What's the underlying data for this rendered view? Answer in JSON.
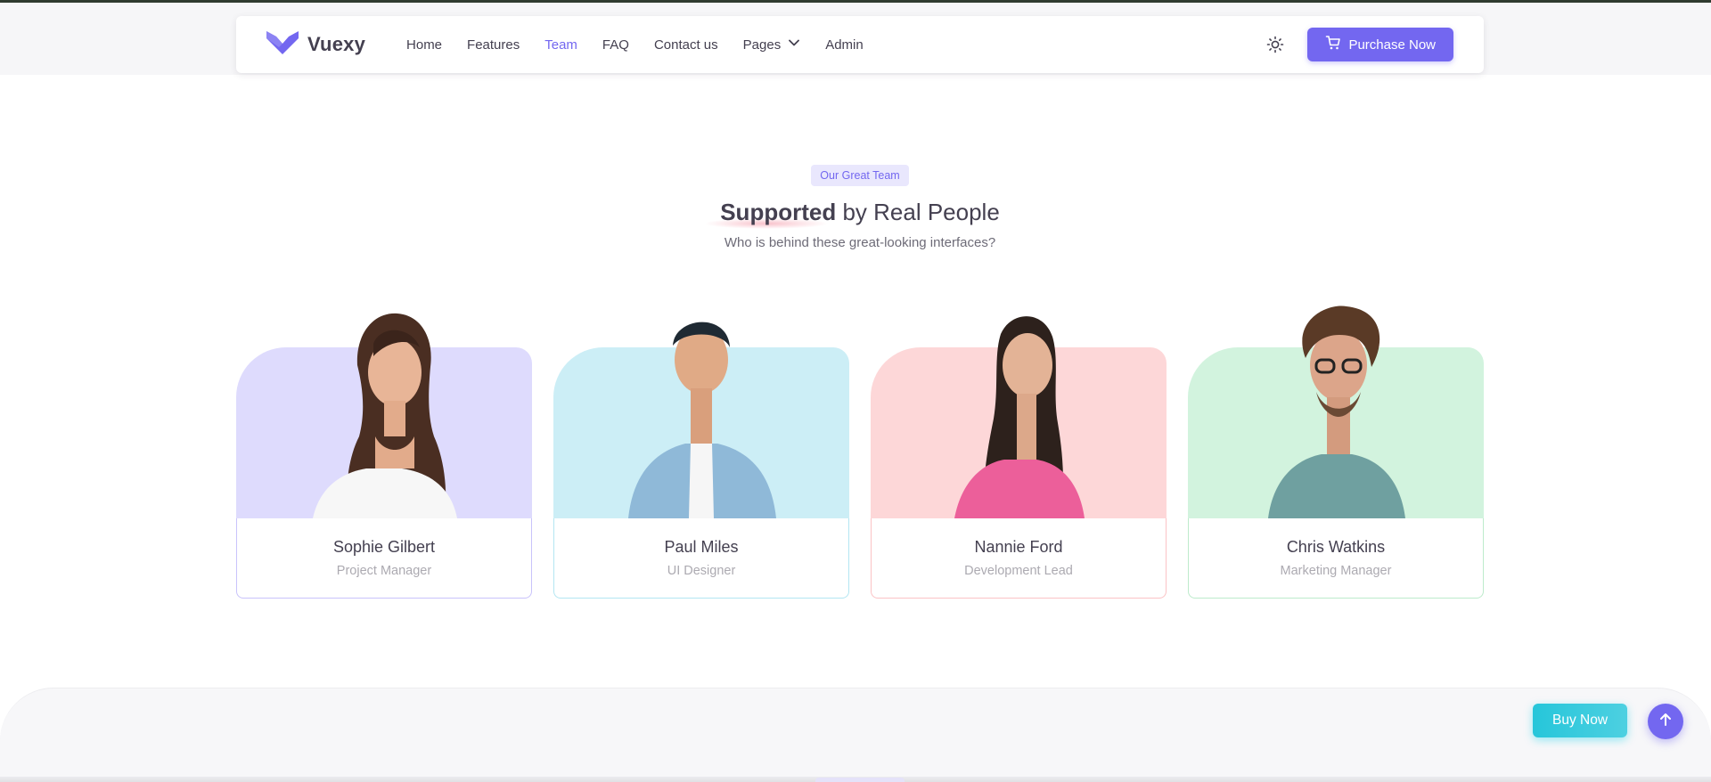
{
  "brand": {
    "name": "Vuexy",
    "accent": "#7367f0"
  },
  "nav": {
    "items": [
      {
        "label": "Home"
      },
      {
        "label": "Features"
      },
      {
        "label": "Team",
        "active": true
      },
      {
        "label": "FAQ"
      },
      {
        "label": "Contact us"
      },
      {
        "label": "Pages",
        "dropdown": true
      },
      {
        "label": "Admin"
      }
    ],
    "theme_icon": "sun-icon",
    "purchase_label": "Purchase Now",
    "purchase_icon": "cart-icon"
  },
  "section": {
    "badge": "Our Great Team",
    "title_strong": "Supported",
    "title_rest": " by Real People",
    "subtitle": "Who is behind these great-looking interfaces?"
  },
  "team": [
    {
      "name": "Sophie Gilbert",
      "role": "Project Manager",
      "bg": "#dedbfd",
      "border": "#c9c3fb"
    },
    {
      "name": "Paul Miles",
      "role": "UI Designer",
      "bg": "#cceef6",
      "border": "#b3e6f2"
    },
    {
      "name": "Nannie Ford",
      "role": "Development Lead",
      "bg": "#fdd7d8",
      "border": "#fbc3c5"
    },
    {
      "name": "Chris Watkins",
      "role": "Marketing Manager",
      "bg": "#d2f3de",
      "border": "#bdebcc"
    }
  ],
  "floating": {
    "buy_now": "Buy Now",
    "scroll_top_icon": "arrow-up-icon"
  }
}
